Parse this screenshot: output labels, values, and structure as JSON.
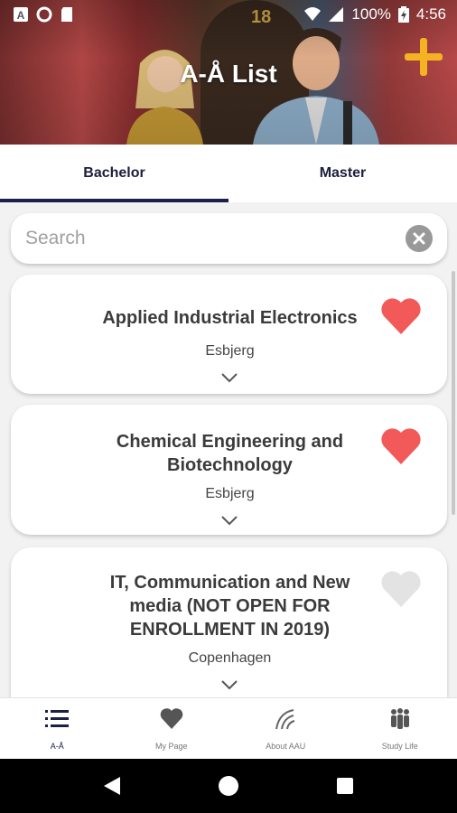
{
  "status_bar": {
    "battery": "100%",
    "time": "4:56",
    "icons": [
      "notification-a-icon",
      "circle-icon",
      "sd-card-icon",
      "wifi-icon",
      "signal-icon",
      "battery-icon"
    ]
  },
  "header": {
    "title": "A-Å List",
    "hero_house_number": "18",
    "add_icon": "plus-icon",
    "accent_color": "#f5b324"
  },
  "tabs": [
    {
      "label": "Bachelor",
      "active": true
    },
    {
      "label": "Master",
      "active": false
    }
  ],
  "search": {
    "placeholder": "Search",
    "value": "",
    "clear_icon": "clear-icon"
  },
  "programmes": [
    {
      "title": "Applied Industrial Electronics",
      "location": "Esbjerg",
      "favorite": true
    },
    {
      "title": "Chemical Engineering and Biotechnology",
      "location": "Esbjerg",
      "favorite": true
    },
    {
      "title": "IT, Communication and New media (NOT OPEN FOR ENROLLMENT IN 2019)",
      "location": "Copenhagen",
      "favorite": false
    }
  ],
  "colors": {
    "heart_active": "#f25a5a",
    "heart_inactive": "#e3e3e3",
    "navy": "#1c1f4a"
  },
  "bottom_nav": [
    {
      "label": "A-Å",
      "icon": "list-icon",
      "active": true
    },
    {
      "label": "My Page",
      "icon": "heart-icon",
      "active": false
    },
    {
      "label": "About AAU",
      "icon": "aau-logo-icon",
      "active": false
    },
    {
      "label": "Study Life",
      "icon": "people-icon",
      "active": false
    }
  ]
}
